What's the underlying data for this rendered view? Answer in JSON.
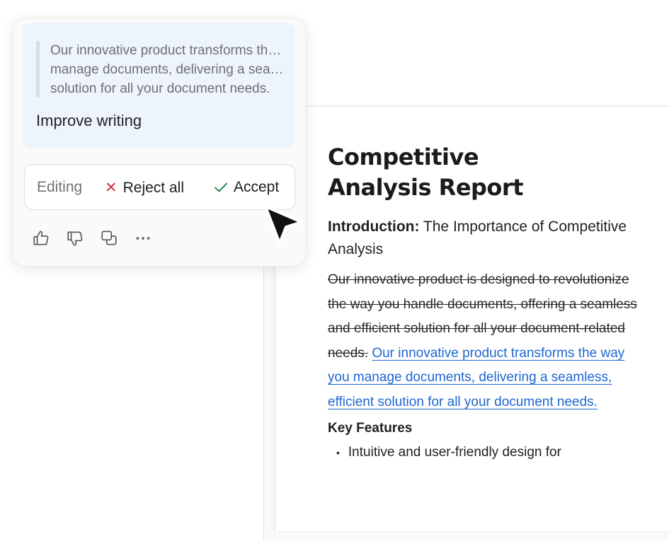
{
  "document": {
    "title_line1": "Competitive",
    "title_line2": "Analysis Report",
    "intro_bold": "Introduction:",
    "intro_rest": " The Importance of Competitive Analysis",
    "deleted_text": "Our innovative product is designed to revolutionize the way you handle documents, offering a seamless and efficient solution for all your document-related needs.",
    "inserted_text": "Our innovative product transforms the way you manage documents, delivering a seamless, efficient solution for all your document needs.",
    "key_features_heading": "Key Features",
    "bullets": [
      "Intuitive and user-friendly design for"
    ]
  },
  "popup": {
    "quote_lines": [
      "Our innovative product transforms the way you",
      "manage documents, delivering a seamless, efficient",
      "solution for all your document needs."
    ],
    "prompt_label": "Improve writing",
    "edit_bar": {
      "mode_label": "Editing",
      "reject_label": "Reject all",
      "accept_label": "Accept"
    },
    "feedback_icons": [
      "thumbs-up-icon",
      "thumbs-down-icon",
      "copy-icon",
      "more-icon"
    ]
  },
  "colors": {
    "inserted_link": "#1f66d1",
    "reject_x": "#d0334b",
    "accept_check": "#2e8a57",
    "prompt_card_bg": "#eef4fd"
  }
}
